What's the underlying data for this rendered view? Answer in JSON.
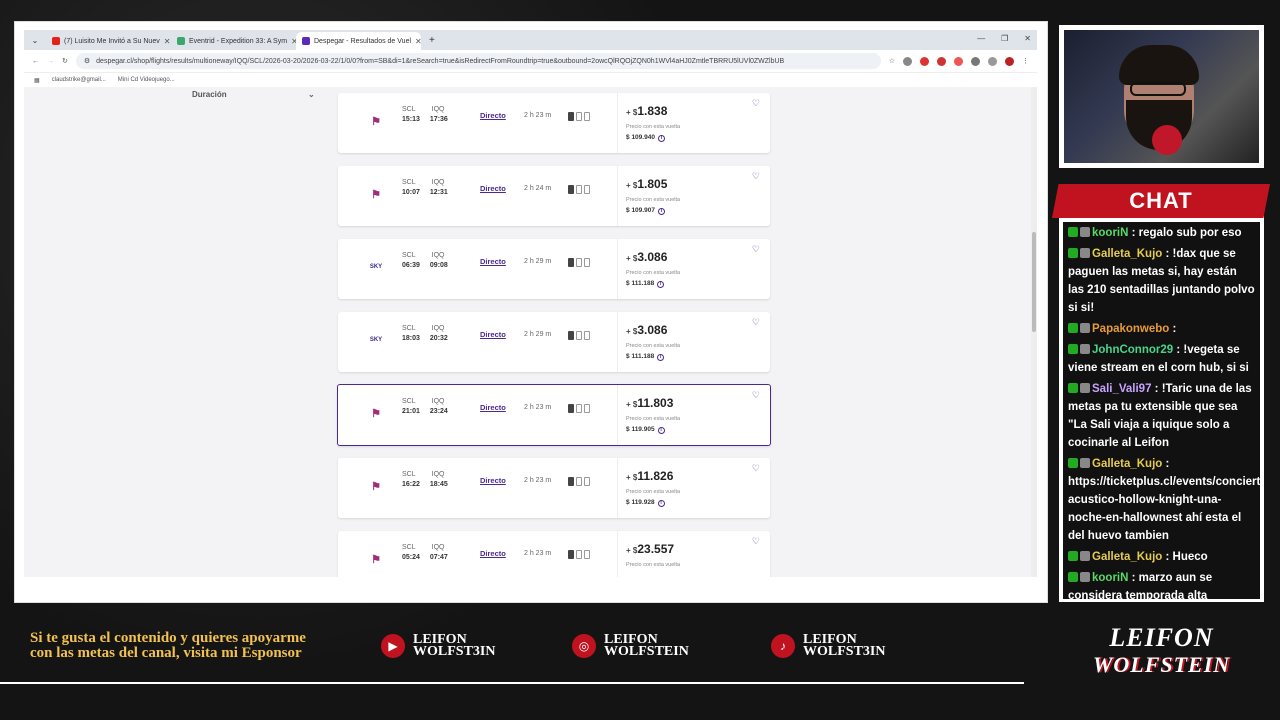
{
  "browser": {
    "tabs": [
      {
        "title": "(7) Luisito Me Invitó a Su Nuev",
        "color": "#e62117"
      },
      {
        "title": "Eventrid - Expedition 33: A Sym",
        "color": "#3aa86b"
      },
      {
        "title": "Despegar - Resultados de Vuel",
        "color": "#5b2bb8"
      }
    ],
    "new_tab": "+",
    "url": "despegar.cl/shop/flights/results/multioneway/IQQ/SCL/2026-03-20/2026-03-22/1/0/0?from=SB&di=1&reSearch=true&isRedirectFromRoundtrip=true&outbound=2owcQlRQOjZQN0h1WVl4aHJ0ZmtleTBRRU5lUVl0ZWZlbUB",
    "bookmarks": [
      "claudstrike@gmail...",
      "Mini Cd Videojuego..."
    ],
    "filter_label": "Duración"
  },
  "flights": [
    {
      "airline": "latam",
      "from": "SCL",
      "to": "IQQ",
      "dep": "15:13",
      "arr": "17:36",
      "stop": "Directo",
      "duration": "2 h 23 m",
      "price": "1.838",
      "note": "Precio con esta vuelta",
      "total": "109.940",
      "selected": false
    },
    {
      "airline": "latam",
      "from": "SCL",
      "to": "IQQ",
      "dep": "10:07",
      "arr": "12:31",
      "stop": "Directo",
      "duration": "2 h 24 m",
      "price": "1.805",
      "note": "Precio con esta vuelta",
      "total": "109.907",
      "selected": false
    },
    {
      "airline": "sky",
      "from": "SCL",
      "to": "IQQ",
      "dep": "06:39",
      "arr": "09:08",
      "stop": "Directo",
      "duration": "2 h 29 m",
      "price": "3.086",
      "note": "Precio con esta vuelta",
      "total": "111.188",
      "selected": false
    },
    {
      "airline": "sky",
      "from": "SCL",
      "to": "IQQ",
      "dep": "18:03",
      "arr": "20:32",
      "stop": "Directo",
      "duration": "2 h 29 m",
      "price": "3.086",
      "note": "Precio con esta vuelta",
      "total": "111.188",
      "selected": false
    },
    {
      "airline": "latam",
      "from": "SCL",
      "to": "IQQ",
      "dep": "21:01",
      "arr": "23:24",
      "stop": "Directo",
      "duration": "2 h 23 m",
      "price": "11.803",
      "note": "Precio con esta vuelta",
      "total": "119.905",
      "selected": true
    },
    {
      "airline": "latam",
      "from": "SCL",
      "to": "IQQ",
      "dep": "16:22",
      "arr": "18:45",
      "stop": "Directo",
      "duration": "2 h 23 m",
      "price": "11.826",
      "note": "Precio con esta vuelta",
      "total": "119.928",
      "selected": false
    },
    {
      "airline": "latam",
      "from": "SCL",
      "to": "IQQ",
      "dep": "05:24",
      "arr": "07:47",
      "stop": "Directo",
      "duration": "2 h 23 m",
      "price": "23.557",
      "note": "Precio con esta vuelta",
      "total": "",
      "selected": false
    }
  ],
  "price_prefix": "+ $",
  "total_prefix": "$",
  "chat": {
    "title": "CHAT",
    "messages": [
      {
        "user": "kooriN",
        "text": ": regalo sub por eso",
        "cls": "u1"
      },
      {
        "user": "Galleta_Kujo",
        "text": ": !dax que se paguen las metas si, hay están las 210 sentadillas juntando polvo si si!",
        "cls": "u2"
      },
      {
        "user": "Papakonwebo",
        "text": ":",
        "cls": "u3"
      },
      {
        "user": "JohnConnor29",
        "text": ": !vegeta se viene stream en el corn hub, si si",
        "cls": "u4"
      },
      {
        "user": "Sali_Vali97",
        "text": ": !Taric una de las metas pa tu extensible que sea \"La Sali viaja a iquique solo a cocinarle al Leifon",
        "cls": "u5"
      },
      {
        "user": "Galleta_Kujo",
        "text": ": https://ticketplus.cl/events/concierto-acustico-hollow-knight-una-noche-en-hallownest ahí esta el del huevo tambien",
        "cls": "u2"
      },
      {
        "user": "Galleta_Kujo",
        "text": ": Hueco",
        "cls": "u2"
      },
      {
        "user": "kooriN",
        "text": ": marzo aun se considera temporada alta",
        "cls": "u1"
      }
    ]
  },
  "overlay": {
    "sponsor": "Si te gusta el contenido y quieres apoyarme con las metas del canal, visita mi Esponsor",
    "socials": [
      {
        "icon": "youtube-icon",
        "glyph": "▶",
        "line1": "LEIFON",
        "line2": "WOLFST3IN"
      },
      {
        "icon": "instagram-icon",
        "glyph": "◎",
        "line1": "LEIFON",
        "line2": "WOLFSTEIN"
      },
      {
        "icon": "tiktok-icon",
        "glyph": "♪",
        "line1": "LEIFON",
        "line2": "WOLFST3IN"
      }
    ],
    "logo_line1": "LEIFON",
    "logo_line2": "WOLFSTEIN"
  }
}
